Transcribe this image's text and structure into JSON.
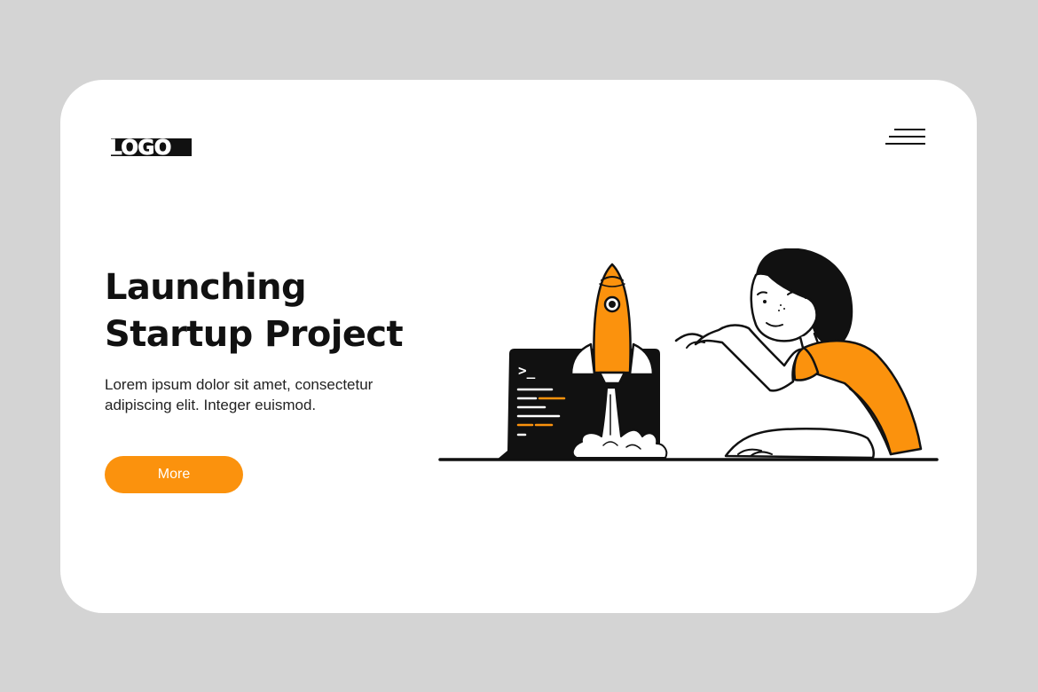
{
  "brand": {
    "logo_text": "LOGO"
  },
  "nav": {
    "menu_icon": "hamburger-menu-icon"
  },
  "hero": {
    "title_line1": "Launching",
    "title_line2": "Startup Project",
    "description": "Lorem ipsum dolor sit amet, consectetur adipiscing elit. Integer euismod.",
    "cta_label": "More"
  },
  "illustration": {
    "terminal_prompt": ">_",
    "subject": "woman-launching-rocket-from-laptop"
  },
  "colors": {
    "accent": "#fb920d",
    "background": "#d4d4d4",
    "card": "#ffffff",
    "ink": "#111111"
  }
}
